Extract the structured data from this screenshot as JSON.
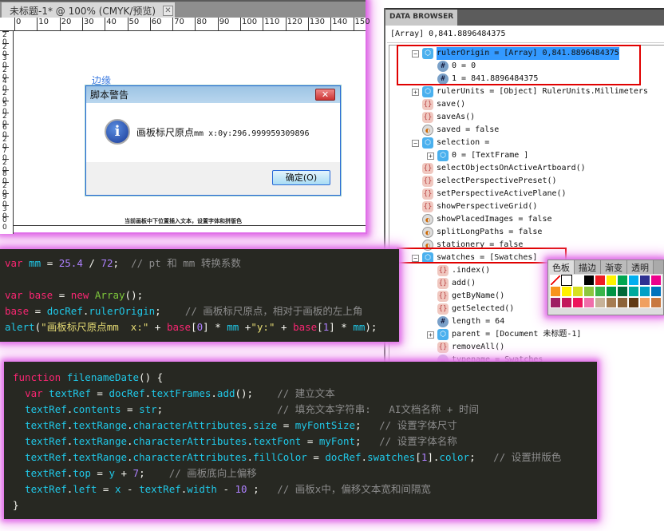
{
  "document": {
    "tab_title": "未标题-1* @ 100% (CMYK/预览)",
    "ruler_top": [
      "0",
      "10",
      "20",
      "30",
      "40",
      "50",
      "60",
      "70",
      "80",
      "90",
      "100",
      "110",
      "120",
      "130",
      "140",
      "150"
    ],
    "ruler_left": [
      "20",
      "20",
      "30",
      "20",
      "40",
      "20",
      "50",
      "20",
      "60",
      "20",
      "70",
      "20",
      "80",
      "20",
      "90",
      "30",
      "00"
    ],
    "edge_label": "边缘",
    "canvas_note": "当前画板中下位置插入文本，设置字体和拼版色"
  },
  "dialog": {
    "title": "脚本警告",
    "message_label": "画板标尺原点",
    "message_value": "mm  x:0y:296.999959309896",
    "ok_label": "确定(O)"
  },
  "data_browser": {
    "tab": "DATA BROWSER",
    "value": "[Array] 0,841.8896484375",
    "rows": [
      {
        "indent": 0,
        "exp": "−",
        "icon": "obj",
        "text": "rulerOrigin = [Array] 0,841.8896484375",
        "selected": true
      },
      {
        "indent": 1,
        "exp": "",
        "icon": "num",
        "text": "0 = 0"
      },
      {
        "indent": 1,
        "exp": "",
        "icon": "num",
        "text": "1 = 841.8896484375"
      },
      {
        "indent": 0,
        "exp": "+",
        "icon": "obj",
        "text": "rulerUnits = [Object] RulerUnits.Millimeters"
      },
      {
        "indent": 0,
        "exp": "",
        "icon": "fn",
        "text": "save()"
      },
      {
        "indent": 0,
        "exp": "",
        "icon": "fn",
        "text": "saveAs()"
      },
      {
        "indent": 0,
        "exp": "",
        "icon": "bool",
        "text": "saved = false"
      },
      {
        "indent": 0,
        "exp": "−",
        "icon": "obj",
        "text": "selection ="
      },
      {
        "indent": 1,
        "exp": "+",
        "icon": "obj",
        "text": "0 = [TextFrame ]"
      },
      {
        "indent": 0,
        "exp": "",
        "icon": "fn",
        "text": "selectObjectsOnActiveArtboard()"
      },
      {
        "indent": 0,
        "exp": "",
        "icon": "fn",
        "text": "selectPerspectivePreset()"
      },
      {
        "indent": 0,
        "exp": "",
        "icon": "fn",
        "text": "setPerspectiveActivePlane()"
      },
      {
        "indent": 0,
        "exp": "",
        "icon": "fn",
        "text": "showPerspectiveGrid()"
      },
      {
        "indent": 0,
        "exp": "",
        "icon": "bool",
        "text": "showPlacedImages = false"
      },
      {
        "indent": 0,
        "exp": "",
        "icon": "bool",
        "text": "splitLongPaths = false"
      },
      {
        "indent": 0,
        "exp": "",
        "icon": "bool",
        "text": "stationery = false"
      },
      {
        "indent": 0,
        "exp": "−",
        "icon": "obj",
        "text": "swatches = [Swatches]"
      },
      {
        "indent": 1,
        "exp": "",
        "icon": "fn",
        "text": ".index()"
      },
      {
        "indent": 1,
        "exp": "",
        "icon": "fn",
        "text": "add()"
      },
      {
        "indent": 1,
        "exp": "",
        "icon": "fn",
        "text": "getByName()"
      },
      {
        "indent": 1,
        "exp": "",
        "icon": "fn",
        "text": "getSelected()"
      },
      {
        "indent": 1,
        "exp": "",
        "icon": "num",
        "text": "length = 64"
      },
      {
        "indent": 1,
        "exp": "+",
        "icon": "obj",
        "text": "parent = [Document 未标题-1]"
      },
      {
        "indent": 1,
        "exp": "",
        "icon": "fn",
        "text": "removeAll()"
      },
      {
        "indent": 1,
        "exp": "",
        "icon": "str",
        "text": "typename = Swatches"
      }
    ]
  },
  "swatches_panel": {
    "tabs": [
      "色板",
      "描边",
      "渐变",
      "透明"
    ],
    "colors": [
      "#ffffff",
      "#ffffff",
      "#ffffff",
      "#000000",
      "#ee1c24",
      "#fff200",
      "#00a651",
      "#00aeef",
      "#2e3192",
      "#ec008c",
      "#f7941d",
      "#fff200",
      "#d7e021",
      "#8dc63f",
      "#39b54a",
      "#009444",
      "#006838",
      "#00a99d",
      "#00a0c6",
      "#0072bc",
      "#9e1f63",
      "#c2185b",
      "#ed145b",
      "#f06eaa",
      "#c7b299",
      "#a67c52",
      "#8c6239",
      "#603813",
      "#f0a060",
      "#c87840"
    ]
  },
  "code1": [
    [
      [
        "kw",
        "var "
      ],
      [
        "id",
        "mm"
      ],
      [
        "p",
        " = "
      ],
      [
        "num",
        "25.4"
      ],
      [
        "p",
        " / "
      ],
      [
        "num",
        "72"
      ],
      [
        "p",
        ";  "
      ],
      [
        "cm",
        "// pt 和 mm 转换系数"
      ]
    ],
    [],
    [
      [
        "kw",
        "var "
      ],
      [
        "kw",
        "base"
      ],
      [
        "p",
        " = "
      ],
      [
        "kw",
        "new "
      ],
      [
        "cls",
        "Array"
      ],
      [
        "p",
        "();"
      ]
    ],
    [
      [
        "kw",
        "base"
      ],
      [
        "p",
        " = "
      ],
      [
        "id",
        "docRef"
      ],
      [
        "p",
        "."
      ],
      [
        "id",
        "rulerOrigin"
      ],
      [
        "p",
        ";    "
      ],
      [
        "cm",
        "// 画板标尺原点，相对于画板的左上角"
      ]
    ],
    [
      [
        "id",
        "alert"
      ],
      [
        "p",
        "("
      ],
      [
        "str",
        "\"画板标尺原点mm  x:\""
      ],
      [
        "p",
        " + "
      ],
      [
        "kw",
        "base"
      ],
      [
        "p",
        "["
      ],
      [
        "num",
        "0"
      ],
      [
        "p",
        "] * "
      ],
      [
        "id",
        "mm"
      ],
      [
        "p",
        " +"
      ],
      [
        "str",
        "\"y:\""
      ],
      [
        "p",
        " + "
      ],
      [
        "kw",
        "base"
      ],
      [
        "p",
        "["
      ],
      [
        "num",
        "1"
      ],
      [
        "p",
        "] * "
      ],
      [
        "id",
        "mm"
      ],
      [
        "p",
        ");"
      ]
    ]
  ],
  "code2": [
    [
      [
        "kw",
        "function "
      ],
      [
        "id",
        "filenameDate"
      ],
      [
        "p",
        "() {"
      ]
    ],
    [
      [
        "p",
        "  "
      ],
      [
        "kw",
        "var "
      ],
      [
        "id",
        "textRef"
      ],
      [
        "p",
        " = "
      ],
      [
        "id",
        "docRef"
      ],
      [
        "p",
        "."
      ],
      [
        "id",
        "textFrames"
      ],
      [
        "p",
        "."
      ],
      [
        "id",
        "add"
      ],
      [
        "p",
        "();    "
      ],
      [
        "cm",
        "// 建立文本"
      ]
    ],
    [
      [
        "p",
        "  "
      ],
      [
        "id",
        "textRef"
      ],
      [
        "p",
        "."
      ],
      [
        "id",
        "contents"
      ],
      [
        "p",
        " = "
      ],
      [
        "id",
        "str"
      ],
      [
        "p",
        ";                   "
      ],
      [
        "cm",
        "// 填充文本字符串:   AI文档名称 + 时间"
      ]
    ],
    [
      [
        "p",
        "  "
      ],
      [
        "id",
        "textRef"
      ],
      [
        "p",
        "."
      ],
      [
        "id",
        "textRange"
      ],
      [
        "p",
        "."
      ],
      [
        "id",
        "characterAttributes"
      ],
      [
        "p",
        "."
      ],
      [
        "id",
        "size"
      ],
      [
        "p",
        " = "
      ],
      [
        "id",
        "myFontSize"
      ],
      [
        "p",
        ";   "
      ],
      [
        "cm",
        "// 设置字体尺寸"
      ]
    ],
    [
      [
        "p",
        "  "
      ],
      [
        "id",
        "textRef"
      ],
      [
        "p",
        "."
      ],
      [
        "id",
        "textRange"
      ],
      [
        "p",
        "."
      ],
      [
        "id",
        "characterAttributes"
      ],
      [
        "p",
        "."
      ],
      [
        "id",
        "textFont"
      ],
      [
        "p",
        " = "
      ],
      [
        "id",
        "myFont"
      ],
      [
        "p",
        ";   "
      ],
      [
        "cm",
        "// 设置字体名称"
      ]
    ],
    [
      [
        "p",
        "  "
      ],
      [
        "id",
        "textRef"
      ],
      [
        "p",
        "."
      ],
      [
        "id",
        "textRange"
      ],
      [
        "p",
        "."
      ],
      [
        "id",
        "characterAttributes"
      ],
      [
        "p",
        "."
      ],
      [
        "id",
        "fillColor"
      ],
      [
        "p",
        " = "
      ],
      [
        "id",
        "docRef"
      ],
      [
        "p",
        "."
      ],
      [
        "id",
        "swatches"
      ],
      [
        "p",
        "["
      ],
      [
        "num",
        "1"
      ],
      [
        "p",
        "]."
      ],
      [
        "id",
        "color"
      ],
      [
        "p",
        ";   "
      ],
      [
        "cm",
        "// 设置拼版色"
      ]
    ],
    [
      [
        "p",
        "  "
      ],
      [
        "id",
        "textRef"
      ],
      [
        "p",
        "."
      ],
      [
        "id",
        "top"
      ],
      [
        "p",
        " = "
      ],
      [
        "id",
        "y"
      ],
      [
        "p",
        " + "
      ],
      [
        "num",
        "7"
      ],
      [
        "p",
        ";    "
      ],
      [
        "cm",
        "// 画板底向上偏移"
      ]
    ],
    [
      [
        "p",
        "  "
      ],
      [
        "id",
        "textRef"
      ],
      [
        "p",
        "."
      ],
      [
        "id",
        "left"
      ],
      [
        "p",
        " = "
      ],
      [
        "id",
        "x"
      ],
      [
        "p",
        " - "
      ],
      [
        "id",
        "textRef"
      ],
      [
        "p",
        "."
      ],
      [
        "id",
        "width"
      ],
      [
        "p",
        " - "
      ],
      [
        "num",
        "10"
      ],
      [
        "p",
        " ;   "
      ],
      [
        "cm",
        "// 画板x中，偏移文本宽和间隔宽"
      ]
    ],
    [
      [
        "p",
        "}"
      ]
    ]
  ]
}
